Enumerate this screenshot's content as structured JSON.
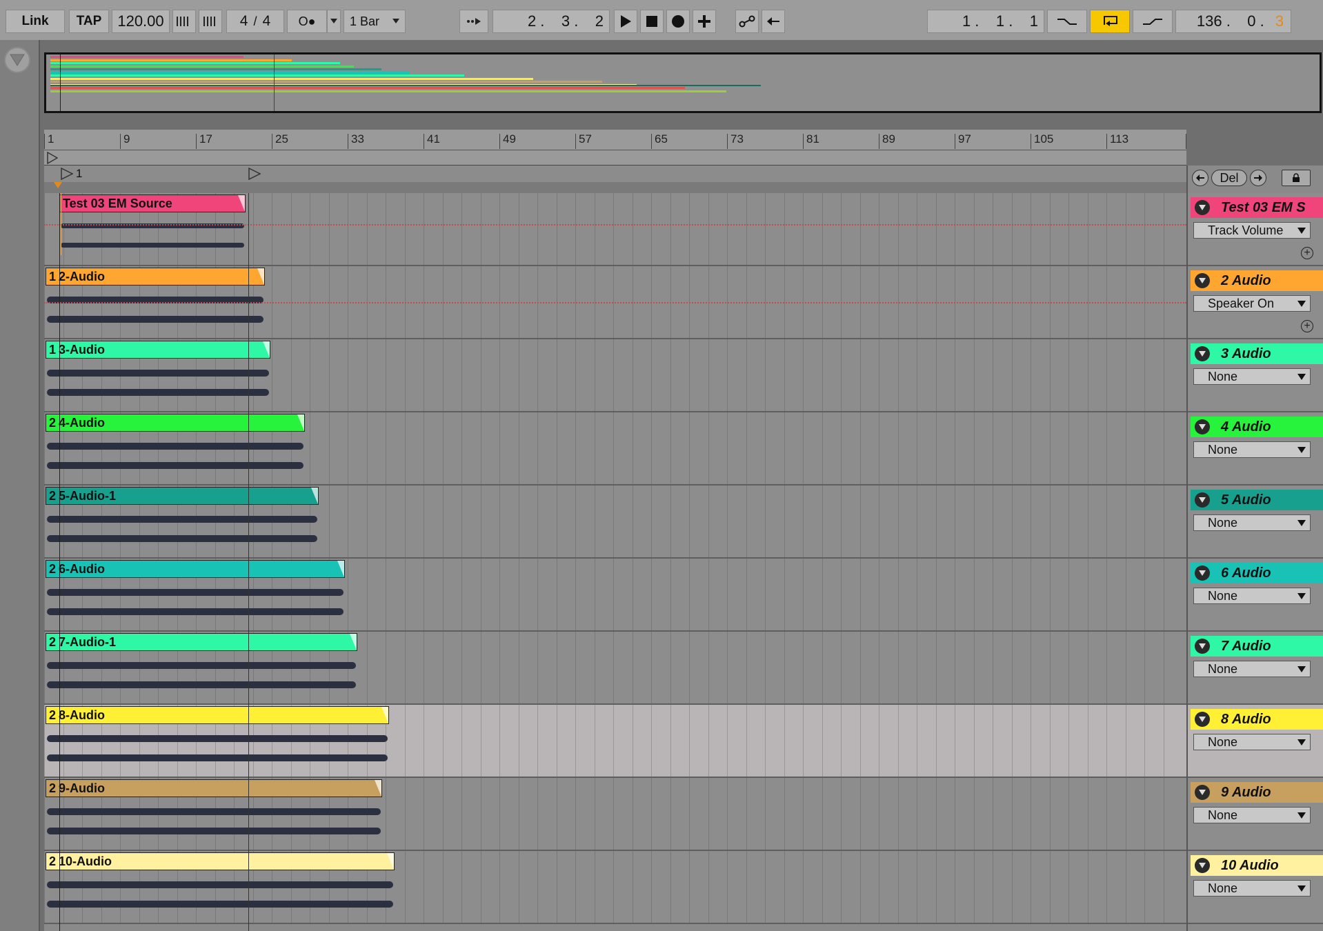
{
  "toolbar": {
    "link_label": "Link",
    "tap_label": "TAP",
    "tempo": "120.00",
    "nudge_down_icon": "nudge-down-icon",
    "nudge_up_icon": "nudge-up-icon",
    "sig_num": "4",
    "sig_sep": "/",
    "sig_den": "4",
    "metronome_label": "O●",
    "quantize_label": "1 Bar",
    "follow_icon": "follow-icon",
    "position": "2 .    3 .    2",
    "play_icon": "play-icon",
    "stop_icon": "stop-icon",
    "record_icon": "record-icon",
    "overdub_icon": "plus-icon",
    "automation_arm_icon": "automation-icon",
    "back_to_arrangement_icon": "arrow-left-icon",
    "loop_start": "1 .    1 .    1",
    "punch_in_icon": "punch-in-icon",
    "loop_switch_icon": "loop-icon",
    "punch_out_icon": "punch-out-icon",
    "loop_length_main": "136 .    0 .",
    "loop_length_sub": "3"
  },
  "ruler": {
    "marks": [
      "1",
      "9",
      "17",
      "25",
      "33",
      "41",
      "49",
      "57",
      "65",
      "73",
      "81",
      "89",
      "97",
      "105",
      "113"
    ]
  },
  "locators": {
    "marker_label": "1",
    "prev_icon": "arrow-left-circle-icon",
    "delete_label": "Del",
    "next_icon": "arrow-right-circle-icon",
    "lock_icon": "lock-icon"
  },
  "tracks": [
    {
      "name": "Test 03 EM S",
      "clip": "Test 03 EM Source",
      "clip_prefix": "",
      "color": "#f0457a",
      "chooser": "Track Volume"
    },
    {
      "name": "2 Audio",
      "clip": "2-Audio",
      "clip_prefix": "1",
      "color": "#ffa630",
      "chooser": "Speaker On"
    },
    {
      "name": "3 Audio",
      "clip": "3-Audio",
      "clip_prefix": "1",
      "color": "#2ef7a5",
      "chooser": "None"
    },
    {
      "name": "4 Audio",
      "clip": "4-Audio",
      "clip_prefix": "2",
      "color": "#27f23c",
      "chooser": "None"
    },
    {
      "name": "5 Audio",
      "clip": "5-Audio-1",
      "clip_prefix": "2",
      "color": "#18a08e",
      "chooser": "None"
    },
    {
      "name": "6 Audio",
      "clip": "6-Audio",
      "clip_prefix": "2",
      "color": "#18c3b6",
      "chooser": "None"
    },
    {
      "name": "7 Audio",
      "clip": "7-Audio-1",
      "clip_prefix": "2",
      "color": "#2ef7a5",
      "chooser": "None"
    },
    {
      "name": "8 Audio",
      "clip": "8-Audio",
      "clip_prefix": "2",
      "color": "#fff035",
      "chooser": "None"
    },
    {
      "name": "9 Audio",
      "clip": "9-Audio",
      "clip_prefix": "2",
      "color": "#c7a05f",
      "chooser": "None"
    },
    {
      "name": "10 Audio",
      "clip": "10-Audio",
      "clip_prefix": "2",
      "color": "#fff1a0",
      "chooser": "None"
    }
  ],
  "track_headers": {
    "fold_icon": "fold-triangle-icon",
    "add_lane_icon": "plus-circle-icon"
  },
  "overview": {
    "colors": [
      "#f0457a",
      "#ffa630",
      "#2ef7a5",
      "#27f23c",
      "#18a08e",
      "#18c3b6",
      "#2ef7a5",
      "#fff035",
      "#c7a05f",
      "#fff1a0",
      "#e0534f",
      "#9ad030"
    ]
  }
}
